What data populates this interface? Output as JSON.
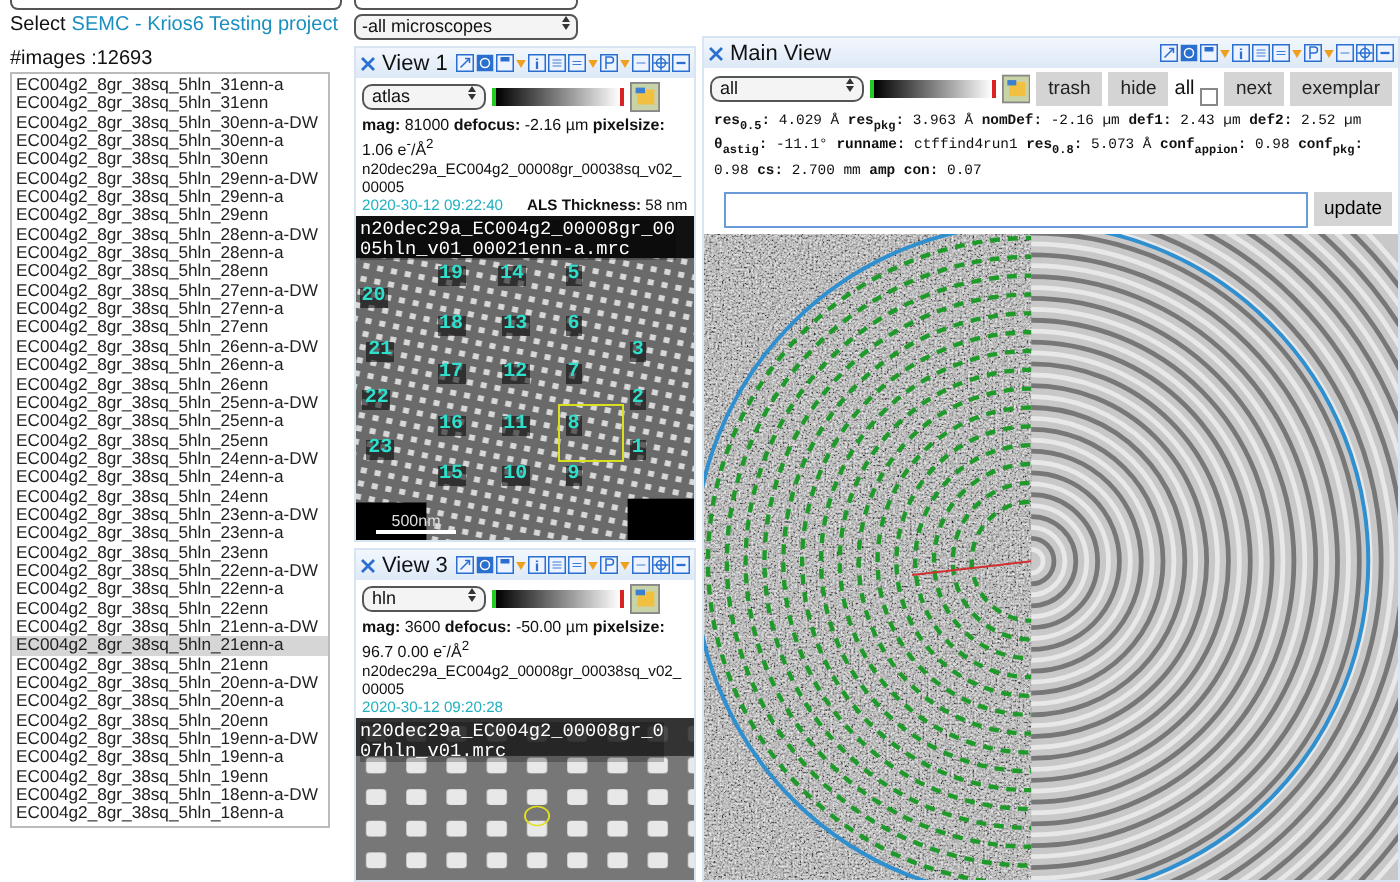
{
  "project_line": {
    "prefix": "Select",
    "link": "SEMC - Krios6 Testing project"
  },
  "image_count": "#images :12693",
  "images": [
    {
      "name": "EC004g2_8gr_38sq_5hln_31enn-a",
      "selected": false
    },
    {
      "name": "EC004g2_8gr_38sq_5hln_31enn",
      "selected": false
    },
    {
      "name": "EC004g2_8gr_38sq_5hln_30enn-a-DW",
      "selected": false
    },
    {
      "name": "EC004g2_8gr_38sq_5hln_30enn-a",
      "selected": false
    },
    {
      "name": "EC004g2_8gr_38sq_5hln_30enn",
      "selected": false
    },
    {
      "name": "EC004g2_8gr_38sq_5hln_29enn-a-DW",
      "selected": false
    },
    {
      "name": "EC004g2_8gr_38sq_5hln_29enn-a",
      "selected": false
    },
    {
      "name": "EC004g2_8gr_38sq_5hln_29enn",
      "selected": false
    },
    {
      "name": "EC004g2_8gr_38sq_5hln_28enn-a-DW",
      "selected": false
    },
    {
      "name": "EC004g2_8gr_38sq_5hln_28enn-a",
      "selected": false
    },
    {
      "name": "EC004g2_8gr_38sq_5hln_28enn",
      "selected": false
    },
    {
      "name": "EC004g2_8gr_38sq_5hln_27enn-a-DW",
      "selected": false
    },
    {
      "name": "EC004g2_8gr_38sq_5hln_27enn-a",
      "selected": false
    },
    {
      "name": "EC004g2_8gr_38sq_5hln_27enn",
      "selected": false
    },
    {
      "name": "EC004g2_8gr_38sq_5hln_26enn-a-DW",
      "selected": false
    },
    {
      "name": "EC004g2_8gr_38sq_5hln_26enn-a",
      "selected": false
    },
    {
      "name": "EC004g2_8gr_38sq_5hln_26enn",
      "selected": false
    },
    {
      "name": "EC004g2_8gr_38sq_5hln_25enn-a-DW",
      "selected": false
    },
    {
      "name": "EC004g2_8gr_38sq_5hln_25enn-a",
      "selected": false
    },
    {
      "name": "EC004g2_8gr_38sq_5hln_25enn",
      "selected": false
    },
    {
      "name": "EC004g2_8gr_38sq_5hln_24enn-a-DW",
      "selected": false
    },
    {
      "name": "EC004g2_8gr_38sq_5hln_24enn-a",
      "selected": false
    },
    {
      "name": "EC004g2_8gr_38sq_5hln_24enn",
      "selected": false
    },
    {
      "name": "EC004g2_8gr_38sq_5hln_23enn-a-DW",
      "selected": false
    },
    {
      "name": "EC004g2_8gr_38sq_5hln_23enn-a",
      "selected": false
    },
    {
      "name": "EC004g2_8gr_38sq_5hln_23enn",
      "selected": false
    },
    {
      "name": "EC004g2_8gr_38sq_5hln_22enn-a-DW",
      "selected": false
    },
    {
      "name": "EC004g2_8gr_38sq_5hln_22enn-a",
      "selected": false
    },
    {
      "name": "EC004g2_8gr_38sq_5hln_22enn",
      "selected": false
    },
    {
      "name": "EC004g2_8gr_38sq_5hln_21enn-a-DW",
      "selected": false
    },
    {
      "name": "EC004g2_8gr_38sq_5hln_21enn-a",
      "selected": true
    },
    {
      "name": "EC004g2_8gr_38sq_5hln_21enn",
      "selected": false
    },
    {
      "name": "EC004g2_8gr_38sq_5hln_20enn-a-DW",
      "selected": false
    },
    {
      "name": "EC004g2_8gr_38sq_5hln_20enn-a",
      "selected": false
    },
    {
      "name": "EC004g2_8gr_38sq_5hln_20enn",
      "selected": false
    },
    {
      "name": "EC004g2_8gr_38sq_5hln_19enn-a-DW",
      "selected": false
    },
    {
      "name": "EC004g2_8gr_38sq_5hln_19enn-a",
      "selected": false
    },
    {
      "name": "EC004g2_8gr_38sq_5hln_19enn",
      "selected": false
    },
    {
      "name": "EC004g2_8gr_38sq_5hln_18enn-a-DW",
      "selected": false
    },
    {
      "name": "EC004g2_8gr_38sq_5hln_18enn-a",
      "selected": false
    }
  ],
  "microscope_select": {
    "value": "-all microscopes"
  },
  "views": [
    {
      "title": "View 1",
      "preset": "atlas",
      "info": "**mag:** 81000 **defocus:** -2.16 µm **pixelsize:** 1.06 e$^{-}$/Å$^{2}$",
      "filename": "n20dec29a_EC004g2_00008gr_00038sq_v02_00005",
      "timestamp": "2020-30-12 09:22:40",
      "thickness": "**ALS Thickness:** 58 nm",
      "image": {
        "kind": "atlas",
        "caption": [
          "n20dec29a_EC004g2_00008gr_00",
          "05hln_v01_00021enn-a.mrc"
        ],
        "scale_bar": "500nm",
        "markers": [
          "19",
          "14",
          "5",
          "20",
          "18",
          "13",
          "6",
          "21",
          "3",
          "17",
          "12",
          "7",
          "22",
          "2",
          "16",
          "11",
          "8",
          "23",
          "1",
          "15",
          "10",
          "9"
        ]
      }
    },
    {
      "title": "View 3",
      "preset": "hln",
      "info": "**mag:** 3600 **defocus:** -50.00 µm **pixelsize:** 96.7 0.00 e$^{-}$/Å$^{2}$",
      "filename": "n20dec29a_EC004g2_00008gr_00038sq_v02_00005",
      "timestamp": "2020-30-12 09:20:28",
      "image": {
        "kind": "holes",
        "caption": [
          "n20dec29a_EC004g2_00008gr_0",
          "07hln_v01.mrc"
        ]
      }
    }
  ],
  "main_view": {
    "title": "Main View",
    "preset": "all",
    "buttons": [
      "trash",
      "hide"
    ],
    "all_toggle": {
      "label": "all",
      "checked": false
    },
    "nav_buttons": [
      "next",
      "exemplar"
    ],
    "ctf_info": "**res$_{0.5}$:** 4.029 Å **res$_{pkg}$:** 3.963 Å **nomDef:** -2.16 µm **def1:** 2.43 µm **def2:** 2.52 µm **θ$_{astig}$:** -11.1° **runname:** ctffind4run1 **res$_{0.8}$:** 5.073 Å **conf$_{appion}$:** 0.98 **conf$_{pkg}$:** 0.98 **cs:** 2.700 mm **amp con:** 0.07",
    "update_button": "update"
  }
}
